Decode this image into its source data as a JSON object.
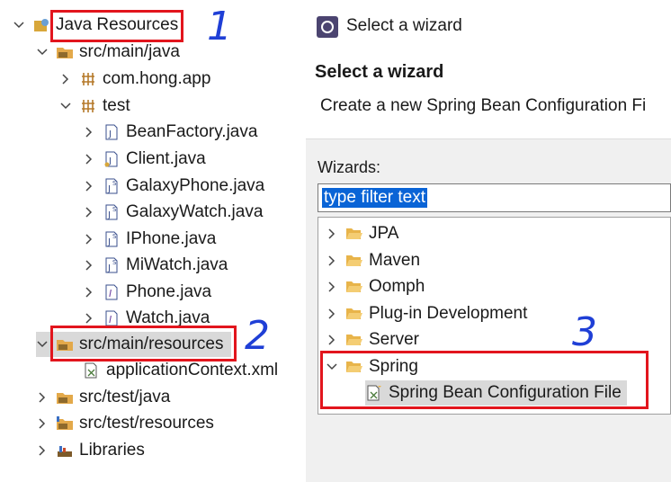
{
  "project_tree": {
    "root": "Java Resources",
    "src_main_java": "src/main/java",
    "pkg_app": "com.hong.app",
    "pkg_test": "test",
    "files": [
      "BeanFactory.java",
      "Client.java",
      "GalaxyPhone.java",
      "GalaxyWatch.java",
      "IPhone.java",
      "MiWatch.java",
      "Phone.java",
      "Watch.java"
    ],
    "src_main_resources": "src/main/resources",
    "app_context": "applicationContext.xml",
    "src_test_java": "src/test/java",
    "src_test_resources": "src/test/resources",
    "libraries": "Libraries"
  },
  "dialog": {
    "window_title": "Select a wizard",
    "header_title": "Select a wizard",
    "header_desc": "Create a new Spring Bean Configuration Fi",
    "wizards_label": "Wizards:",
    "filter_value": "type filter text",
    "categories": [
      "JPA",
      "Maven",
      "Oomph",
      "Plug-in Development",
      "Server",
      "Spring"
    ],
    "spring_child": "Spring Bean Configuration File"
  },
  "annotations": {
    "one": "1",
    "two": "2",
    "three": "3"
  },
  "colors": {
    "highlight_box": "#e2151d",
    "annotation_ink": "#1f3fd6",
    "selection": "#0a64d6"
  }
}
